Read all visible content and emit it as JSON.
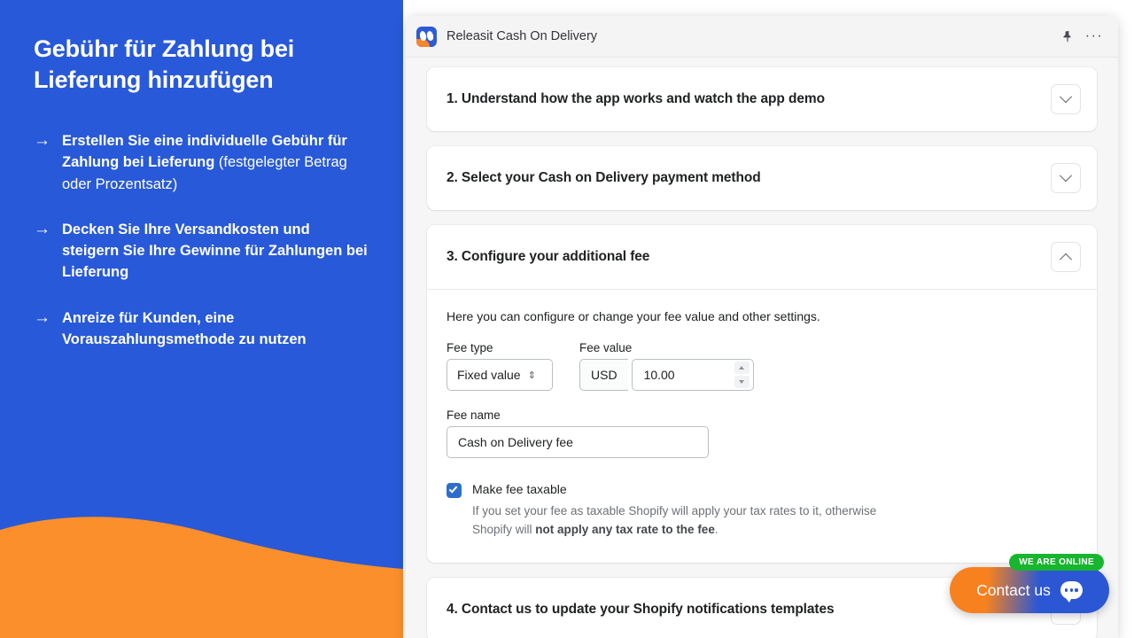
{
  "promo": {
    "title": "Gebühr für Zahlung bei Lieferung hinzufügen",
    "arrow_icon": "→",
    "bullets": [
      {
        "bold": "Erstellen Sie eine individuelle Gebühr für Zahlung bei Lieferung ",
        "light": "(festgelegter Betrag oder Prozentsatz)"
      },
      {
        "bold": "Decken Sie Ihre Versandkosten und steigern Sie Ihre Gewinne für Zahlungen bei Lieferung",
        "light": ""
      },
      {
        "bold": "Anreize für Kunden, eine Vorauszahlungsmethode zu nutzen",
        "light": ""
      }
    ],
    "background_color": "#2859d8",
    "wave_color": "#fa8f2b"
  },
  "window": {
    "app_title": "Releasit Cash On Delivery",
    "pin_icon": "pin-icon",
    "more_icon": "···"
  },
  "sections": [
    {
      "title": "1. Understand how the app works and watch the app demo",
      "expanded": false
    },
    {
      "title": "2. Select your Cash on Delivery payment method",
      "expanded": false
    },
    {
      "title": "3. Configure your additional fee",
      "expanded": true
    },
    {
      "title": "4. Contact us to update your Shopify notifications templates",
      "expanded": false
    }
  ],
  "fee_form": {
    "intro": "Here you can configure or change your fee value and other settings.",
    "fee_type_label": "Fee type",
    "fee_type_value": "Fixed value",
    "fee_type_caret": "⇕",
    "fee_value_label": "Fee value",
    "currency_prefix": "USD",
    "fee_value": "10.00",
    "fee_name_label": "Fee name",
    "fee_name_value": "Cash on Delivery fee",
    "taxable_checked": true,
    "taxable_label": "Make fee taxable",
    "taxable_help_start": "If you set your fee as taxable Shopify will apply your tax rates to it, otherwise Shopify will ",
    "taxable_help_bold": "not apply any tax rate to the fee",
    "taxable_help_end": "."
  },
  "chat": {
    "badge": "WE ARE ONLINE",
    "label": "Contact us",
    "icon": "chat-bubble-icon",
    "badge_color": "#18b52e"
  }
}
